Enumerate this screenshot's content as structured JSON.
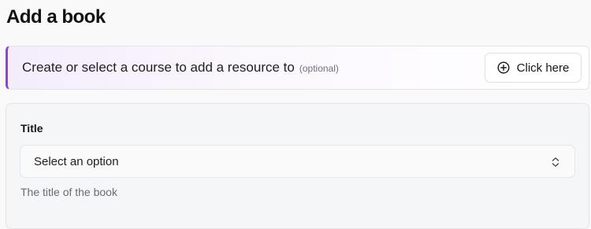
{
  "page": {
    "title": "Add a book"
  },
  "callout": {
    "text": "Create or select a course to add a resource to",
    "optional": "(optional)",
    "button_label": "Click here",
    "accent_color": "#8b46d6"
  },
  "form": {
    "title_field": {
      "label": "Title",
      "selected_value": "Select an option",
      "helper": "The title of the book"
    }
  },
  "icons": {
    "add": "plus-circle-icon",
    "select": "chevron-up-down-icon"
  }
}
